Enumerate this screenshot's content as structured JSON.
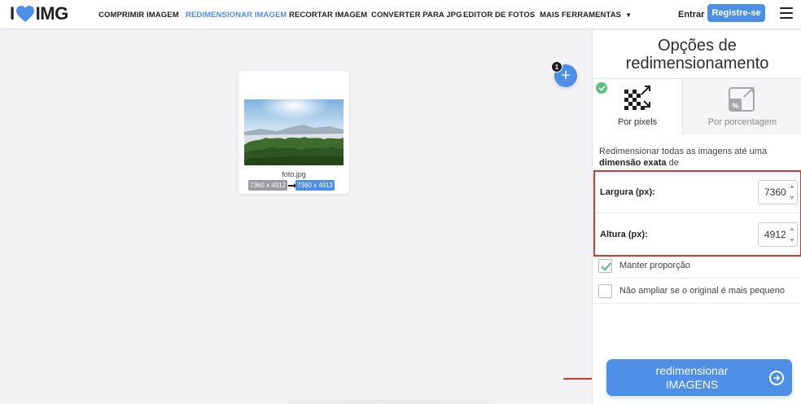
{
  "header": {
    "logo_left": "I",
    "logo_right": "IMG",
    "nav": [
      {
        "label": "COMPRIMIR IMAGEM"
      },
      {
        "label": "REDIMENSIONAR IMAGEM"
      },
      {
        "label": "RECORTAR IMAGEM"
      },
      {
        "label": "CONVERTER PARA JPG"
      },
      {
        "label": "EDITOR DE FOTOS"
      },
      {
        "label": "MAIS FERRAMENTAS"
      }
    ],
    "login": "Entrar",
    "register": "Registre-se",
    "brand_color": "#4d8ee6"
  },
  "workspace": {
    "add_count": "1",
    "add_symbol": "+",
    "file": {
      "name": "foto.jpg",
      "original_size": "7360 x 4912",
      "new_size": "7360 x 4912"
    }
  },
  "sidebar": {
    "title_line1": "Opções de",
    "title_line2": "redimensionamento",
    "tabs": [
      {
        "label": "Por pixels",
        "icon": "pixels-resize-icon",
        "selected": true
      },
      {
        "label": "Por porcentagem",
        "icon": "percentage-resize-icon",
        "selected": false
      }
    ],
    "description_prefix": "Redimensionar todas as imagens até uma ",
    "description_bold": "dimensão exata",
    "description_suffix": " de",
    "width_label": "Largura (px):",
    "width_value": "7360",
    "height_label": "Altura (px):",
    "height_value": "4912",
    "keep_ratio_label": "Manter proporção",
    "keep_ratio_checked": true,
    "no_upscale_label": "Não ampliar se o original é mais pequeno",
    "no_upscale_checked": false,
    "action_line1": "redimensionar",
    "action_line2": "IMAGENS"
  },
  "colors": {
    "accent": "#4d8ee6",
    "check": "#5fbe7e",
    "highlight": "#d13a33"
  }
}
